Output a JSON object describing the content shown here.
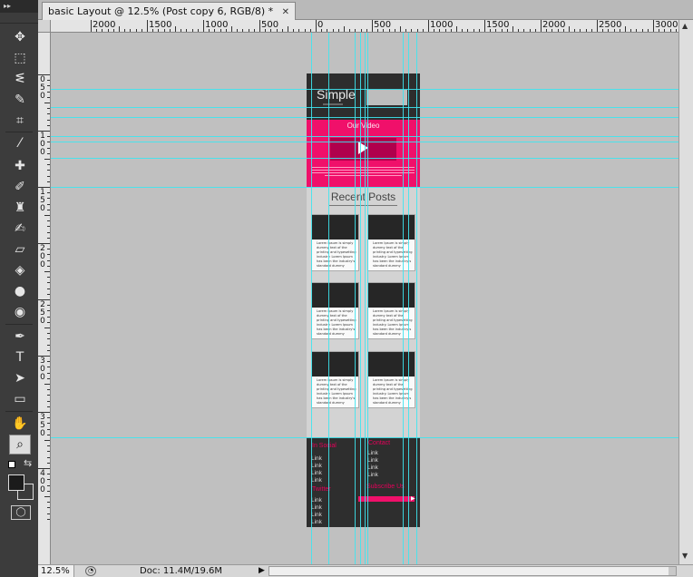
{
  "app": {
    "toolbox_header": "▸▸"
  },
  "document": {
    "tab_title": "basic Layout @ 12.5% (Post copy 6, RGB/8) *",
    "tab_close": "✕"
  },
  "ruler_h": {
    "labels": [
      "2000",
      "1500",
      "1000",
      "500",
      "0",
      "500",
      "1000",
      "1500",
      "2000",
      "2500",
      "3000"
    ]
  },
  "ruler_v": {
    "labels": [
      "0",
      "5",
      "0",
      "1",
      "0",
      "0",
      "1",
      "5",
      "0",
      "2",
      "0",
      "0",
      "2",
      "5",
      "0",
      "3",
      "0",
      "0",
      "3",
      "5",
      "0",
      "4",
      "0",
      "0"
    ]
  },
  "design": {
    "logo": "Simple",
    "video_title": "Our Video",
    "recent_title": "Recent Posts",
    "card_text": "Lorem Ipsum is simply dummy text of the printing and typesetting industry. Lorem Ipsum has been the industry's standard dummy",
    "footer": {
      "social_title": "In Social",
      "social_links": [
        "Link",
        "Link",
        "Link",
        "Link"
      ],
      "twitter_title": "Twitter",
      "twitter_links": [
        "Link",
        "Link",
        "Link",
        "Link"
      ],
      "contact_title": "Contact",
      "contact_links": [
        "Link",
        "Link",
        "Link",
        "Link"
      ],
      "subscribe_title": "Subscribe Us"
    }
  },
  "status": {
    "zoom": "12.5%",
    "doc": "Doc: 11.4M/19.6M",
    "arrow": "▶"
  },
  "colors": {
    "accent_pink": "#f0106a",
    "guide": "#3ee6f0",
    "header_dark": "#2d2d2d"
  },
  "tools": [
    "move-icon",
    "marquee-icon",
    "lasso-icon",
    "quick-select-icon",
    "crop-icon",
    "eyedropper-icon",
    "spot-heal-icon",
    "brush-icon",
    "clone-stamp-icon",
    "history-brush-icon",
    "eraser-icon",
    "paint-bucket-icon",
    "blur-icon",
    "dodge-icon",
    "pen-icon",
    "type-icon",
    "path-select-icon",
    "shape-icon",
    "hand-icon",
    "zoom-icon"
  ]
}
